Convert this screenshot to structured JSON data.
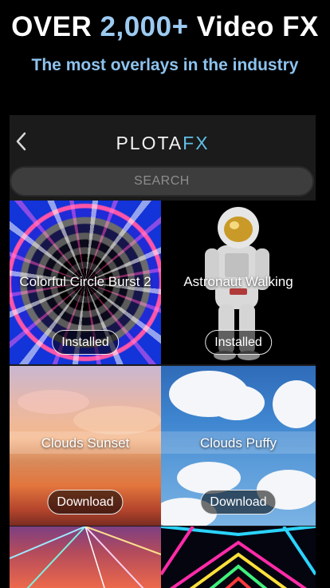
{
  "headline": {
    "part1": "OVER ",
    "accent": "2,000+",
    "part2": " Video FX"
  },
  "subheadline": "The most overlays in the industry",
  "app": {
    "logo_a": "PLOTA",
    "logo_b": "FX",
    "back_icon": "chevron-left-icon",
    "search_placeholder": "SEARCH"
  },
  "tiles": [
    {
      "title": "Colorful Circle Burst 2",
      "action": "Installed"
    },
    {
      "title": "Astronaut Walking",
      "action": "Installed"
    },
    {
      "title": "Clouds Sunset",
      "action": "Download"
    },
    {
      "title": "Clouds Puffy",
      "action": "Download"
    }
  ],
  "colors": {
    "accent": "#9ccaf2",
    "logo_accent": "#5fc1e6",
    "background": "#000000"
  }
}
